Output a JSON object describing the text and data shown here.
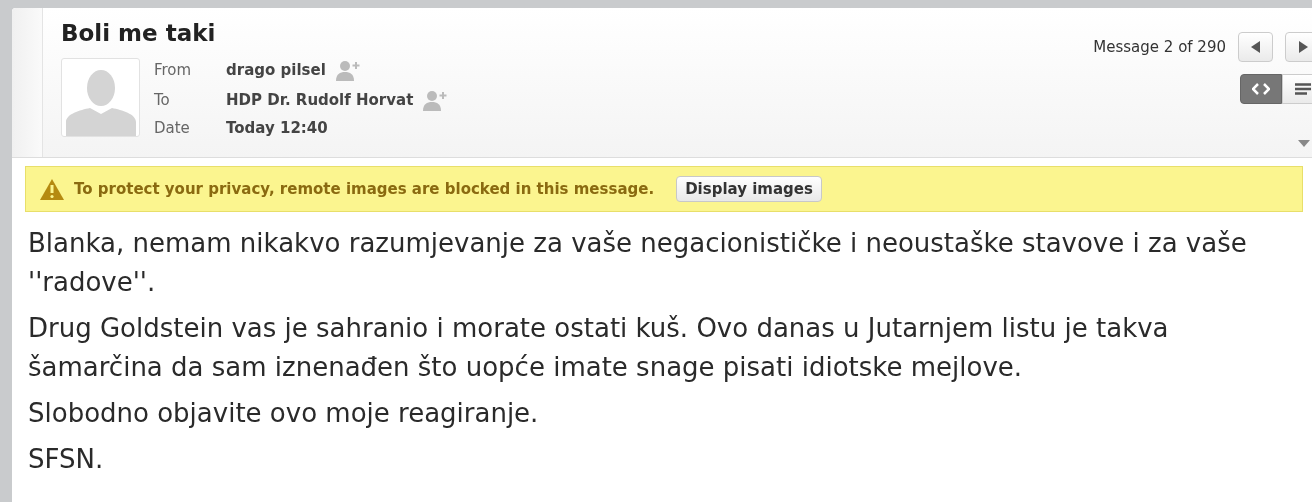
{
  "message": {
    "subject": "Boli me taki",
    "counter": "Message 2 of 290",
    "fields": [
      {
        "label": "From",
        "value": "drago pilsel",
        "add_contact": true
      },
      {
        "label": "To",
        "value": "HDP Dr. Rudolf Horvat",
        "add_contact": true
      },
      {
        "label": "Date",
        "value": "Today 12:40",
        "add_contact": false
      }
    ],
    "view_modes": [
      {
        "kind": "html",
        "selected": true
      },
      {
        "kind": "plain",
        "selected": false
      }
    ]
  },
  "banner": {
    "text": "To protect your privacy, remote images are blocked in this message.",
    "button": "Display images"
  },
  "body": [
    "Blanka, nemam nikakvo razumjevanje za vaše negacionističke i neoustaške stavove i za vaše ''radove''.",
    "Drug Goldstein vas je sahranio i morate ostati kuš. Ovo danas u Jutarnjem listu je takva šamarčina da sam iznenađen što uopće imate snage pisati idiotske mejlove.",
    "Slobodno objavite ovo moje reagiranje.",
    "SFSN."
  ]
}
